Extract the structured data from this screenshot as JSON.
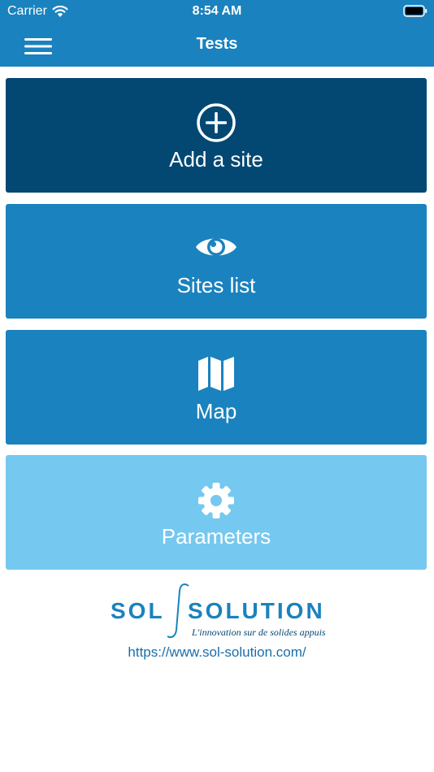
{
  "status_bar": {
    "carrier": "Carrier",
    "time": "8:54 AM",
    "wifi_icon": "wifi-icon",
    "battery_icon": "battery-icon"
  },
  "nav": {
    "title": "Tests",
    "menu_icon": "hamburger-menu-icon"
  },
  "tiles": [
    {
      "label": "Add a site",
      "icon": "plus-circle-icon",
      "color": "#034873"
    },
    {
      "label": "Sites list",
      "icon": "eye-icon",
      "color": "#1a82be"
    },
    {
      "label": "Map",
      "icon": "map-icon",
      "color": "#1a82be"
    },
    {
      "label": "Parameters",
      "icon": "gear-icon",
      "color": "#75c8ef"
    }
  ],
  "logo": {
    "word1": "SOL",
    "word2": "SOLUTION",
    "tagline": "L'innovation sur de solides appuis",
    "color": "#1a82be"
  },
  "website": {
    "url": "https://www.sol-solution.com/"
  },
  "colors": {
    "header": "#1a82be",
    "accent_dark": "#034873",
    "accent_light": "#75c8ef"
  }
}
